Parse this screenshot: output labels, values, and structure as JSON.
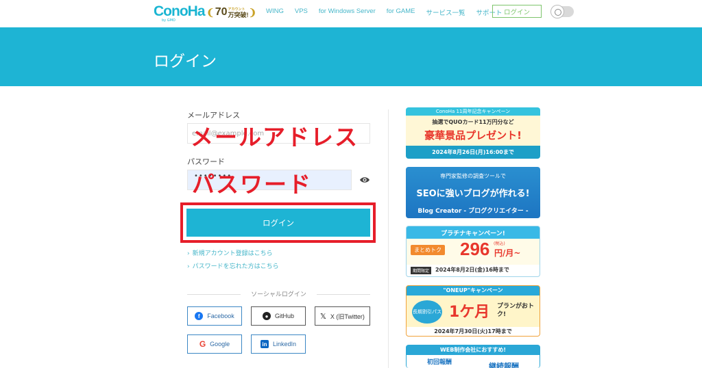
{
  "header": {
    "logo": "ConoHa",
    "logo_sub": "by GMO",
    "badge": "70万突破!",
    "badge_num": "70",
    "badge_small": "アカウント",
    "nav": [
      "WING",
      "VPS",
      "for Windows Server",
      "for GAME",
      "サービス一覧",
      "サポート"
    ],
    "login_button": "ログイン"
  },
  "hero": {
    "title": "ログイン"
  },
  "form": {
    "email_label": "メールアドレス",
    "email_placeholder": "email@example.com",
    "email_annotation": "メールアドレス",
    "password_label": "パスワード",
    "password_value": "••••••••",
    "password_annotation": "パスワード",
    "login_button": "ログイン",
    "links": [
      "新規アカウント登録はこちら",
      "パスワードを忘れた方はこちら"
    ],
    "social_title": "ソーシャルログイン",
    "social": {
      "facebook": "Facebook",
      "github": "GitHub",
      "x": "X (旧Twitter)",
      "google": "Google",
      "linkedin": "LinkedIn"
    }
  },
  "banners": {
    "b1": {
      "top": "ConoHa 11周年記念キャンペーン",
      "mid": "抽選でQUOカード11万円分など",
      "main": "豪華景品プレゼント!",
      "date": "2024年8月26日(月)16:00まで"
    },
    "b2": {
      "top": "専門家監修の調査ツールで",
      "main": "SEOに強いブログが作れる!",
      "brand": "Blog Creator - ブログクリエイター -"
    },
    "b3": {
      "top": "プラチナキャンペーン!",
      "tag": "まとめトク",
      "price": "296",
      "unit": "円/月~",
      "note": "(税込)",
      "period": "期間限定",
      "date": "2024年8月2日(金)16時まで"
    },
    "b4": {
      "top": "\"ONEUP\"キャンペーン",
      "tag": "長期割引パス",
      "main": "1ケ月",
      "plan": "プランがおトク!",
      "date": "2024年7月30日(火)17時まで"
    },
    "b5": {
      "top": "WEB制作会社におすすめ!",
      "tag": "初回報酬",
      "main": "継続報酬"
    }
  }
}
